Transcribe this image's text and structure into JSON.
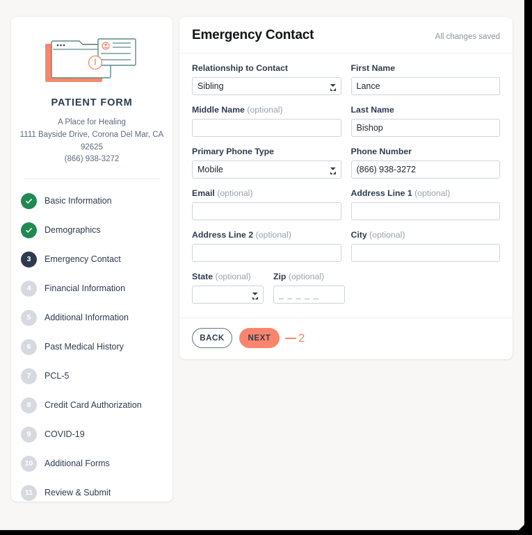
{
  "sidebar": {
    "logo_icon": "browser-window-form-illustration",
    "brand_title": "PATIENT FORM",
    "org_name": "A Place for Healing",
    "address": "1111 Bayside Drive, Corona Del Mar, CA 92625",
    "phone": "(866) 938-3272",
    "steps": [
      {
        "num": "1",
        "label": "Basic Information",
        "state": "done"
      },
      {
        "num": "2",
        "label": "Demographics",
        "state": "done"
      },
      {
        "num": "3",
        "label": "Emergency Contact",
        "state": "active"
      },
      {
        "num": "4",
        "label": "Financial Information",
        "state": "todo"
      },
      {
        "num": "5",
        "label": "Additional Information",
        "state": "todo"
      },
      {
        "num": "6",
        "label": "Past Medical History",
        "state": "todo"
      },
      {
        "num": "7",
        "label": "PCL-5",
        "state": "todo"
      },
      {
        "num": "8",
        "label": "Credit Card Authorization",
        "state": "todo"
      },
      {
        "num": "9",
        "label": "COVID-19",
        "state": "todo"
      },
      {
        "num": "10",
        "label": "Additional Forms",
        "state": "todo"
      },
      {
        "num": "11",
        "label": "Review & Submit",
        "state": "todo"
      }
    ]
  },
  "main": {
    "title": "Emergency Contact",
    "save_status": "All changes saved",
    "fields": {
      "relationship": {
        "label": "Relationship to Contact",
        "optional": "",
        "value": "Sibling",
        "placeholder": ""
      },
      "first_name": {
        "label": "First Name",
        "optional": "",
        "value": "Lance",
        "placeholder": ""
      },
      "middle_name": {
        "label": "Middle Name",
        "optional": "(optional)",
        "value": "",
        "placeholder": ""
      },
      "last_name": {
        "label": "Last Name",
        "optional": "",
        "value": "Bishop",
        "placeholder": ""
      },
      "phone_type": {
        "label": "Primary Phone Type",
        "optional": "",
        "value": "Mobile",
        "placeholder": ""
      },
      "phone_number": {
        "label": "Phone Number",
        "optional": "",
        "value": "(866) 938-3272",
        "placeholder": ""
      },
      "email": {
        "label": "Email",
        "optional": "(optional)",
        "value": "",
        "placeholder": ""
      },
      "address1": {
        "label": "Address Line 1",
        "optional": "(optional)",
        "value": "",
        "placeholder": ""
      },
      "address2": {
        "label": "Address Line 2",
        "optional": "(optional)",
        "value": "",
        "placeholder": ""
      },
      "city": {
        "label": "City",
        "optional": "(optional)",
        "value": "",
        "placeholder": ""
      },
      "state": {
        "label": "State",
        "optional": "(optional)",
        "value": "",
        "placeholder": ""
      },
      "zip": {
        "label": "Zip",
        "optional": "(optional)",
        "value": "",
        "placeholder": "_ _ _ _ _"
      }
    },
    "footer": {
      "back_label": "BACK",
      "next_label": "NEXT",
      "annotation": "2"
    }
  },
  "colors": {
    "accent_coral": "#f9866c",
    "navy": "#2e3b4e",
    "green_done": "#1f8a52",
    "grey_todo": "#d6dae0",
    "page_bg": "#f8f7f5"
  }
}
